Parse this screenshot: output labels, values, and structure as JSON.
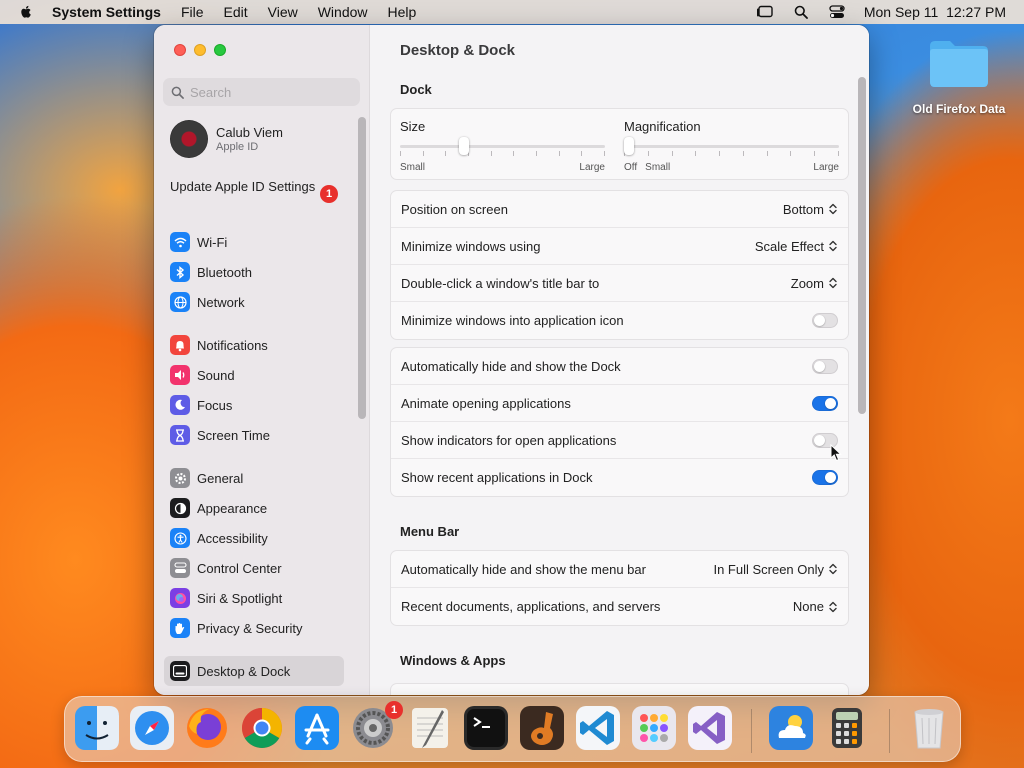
{
  "menubar": {
    "app_name": "System Settings",
    "items": [
      "File",
      "Edit",
      "View",
      "Window",
      "Help"
    ],
    "clock": "Mon Sep 11  12:27 PM"
  },
  "desktop": {
    "folder_label": "Old Firefox Data"
  },
  "sidebar": {
    "search_placeholder": "Search",
    "account_name": "Calub Viem",
    "account_sub": "Apple ID",
    "update_label": "Update Apple ID Settings",
    "update_badge": "1",
    "group1": [
      {
        "label": "Wi-Fi",
        "icon": "wifi-icon",
        "color": "#1a82f7"
      },
      {
        "label": "Bluetooth",
        "icon": "bluetooth-icon",
        "color": "#1a82f7"
      },
      {
        "label": "Network",
        "icon": "globe-icon",
        "color": "#1a82f7"
      }
    ],
    "group2": [
      {
        "label": "Notifications",
        "icon": "bell-icon",
        "color": "#f2453d"
      },
      {
        "label": "Sound",
        "icon": "speaker-icon",
        "color": "#f2336d"
      },
      {
        "label": "Focus",
        "icon": "moon-icon",
        "color": "#5e5ce6"
      },
      {
        "label": "Screen Time",
        "icon": "hourglass-icon",
        "color": "#5e5ce6"
      }
    ],
    "group3": [
      {
        "label": "General",
        "icon": "gear-icon",
        "color": "#8e8e93"
      },
      {
        "label": "Appearance",
        "icon": "appearance-icon",
        "color": "#1c1c1e"
      },
      {
        "label": "Accessibility",
        "icon": "accessibility-icon",
        "color": "#1a82f7"
      },
      {
        "label": "Control Center",
        "icon": "control-center-icon",
        "color": "#8e8e93"
      },
      {
        "label": "Siri & Spotlight",
        "icon": "siri-icon",
        "color": "#7b3fe4"
      },
      {
        "label": "Privacy & Security",
        "icon": "hand-icon",
        "color": "#1a82f7"
      }
    ],
    "selected": {
      "label": "Desktop & Dock",
      "icon": "dock-icon",
      "color": "#1c1c1e"
    }
  },
  "content": {
    "title": "Desktop & Dock",
    "dock_section": "Dock",
    "size": {
      "label": "Size",
      "min_label": "Small",
      "max_label": "Large",
      "value": 0.3
    },
    "magnification": {
      "label": "Magnification",
      "off_label": "Off",
      "min_label": "Small",
      "max_label": "Large",
      "value": 0.0
    },
    "group_a": [
      {
        "label": "Position on screen",
        "kind": "popup",
        "value": "Bottom"
      },
      {
        "label": "Minimize windows using",
        "kind": "popup",
        "value": "Scale Effect"
      },
      {
        "label": "Double-click a window's title bar to",
        "kind": "popup",
        "value": "Zoom"
      },
      {
        "label": "Minimize windows into application icon",
        "kind": "toggle",
        "on": false
      }
    ],
    "group_b": [
      {
        "label": "Automatically hide and show the Dock",
        "kind": "toggle",
        "on": false
      },
      {
        "label": "Animate opening applications",
        "kind": "toggle",
        "on": true
      },
      {
        "label": "Show indicators for open applications",
        "kind": "toggle",
        "on": false
      },
      {
        "label": "Show recent applications in Dock",
        "kind": "toggle",
        "on": true
      }
    ],
    "menubar_section": "Menu Bar",
    "group_c": [
      {
        "label": "Automatically hide and show the menu bar",
        "kind": "popup",
        "value": "In Full Screen Only"
      },
      {
        "label": "Recent documents, applications, and servers",
        "kind": "popup",
        "value": "None"
      }
    ],
    "windows_section": "Windows & Apps"
  },
  "dock": {
    "apps": [
      {
        "name": "finder-icon",
        "color": "#3c9cf0"
      },
      {
        "name": "safari-icon",
        "color": "#e9eef4"
      },
      {
        "name": "firefox-icon",
        "color": "#7a3fd6"
      },
      {
        "name": "chrome-icon",
        "color": "#f2f2f2"
      },
      {
        "name": "app-store-icon",
        "color": "#1d8cf2"
      },
      {
        "name": "system-settings-icon",
        "color": "#8b8b90"
      },
      {
        "name": "textedit-icon",
        "color": "#f4f1ea"
      },
      {
        "name": "terminal-icon",
        "color": "#1e1e1e"
      },
      {
        "name": "garageband-icon",
        "color": "#3b2a20"
      },
      {
        "name": "vscode-icon",
        "color": "#f4f6f9"
      },
      {
        "name": "launchpad-icon",
        "color": "#e9e7ee"
      },
      {
        "name": "visual-studio-icon",
        "color": "#f4f1fa"
      },
      {
        "name": "weather-icon",
        "color": "#2d83e0"
      },
      {
        "name": "calculator-icon",
        "color": "#d8d6d3"
      },
      {
        "name": "trash-icon",
        "color": "#e4e4e6"
      }
    ],
    "settings_badge": "1"
  }
}
